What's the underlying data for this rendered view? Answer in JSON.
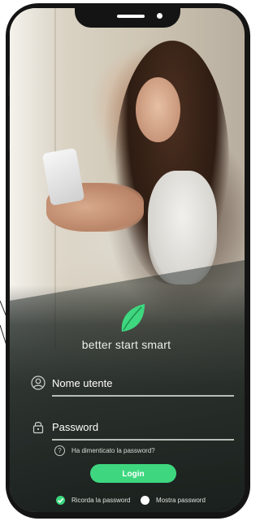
{
  "brand": {
    "slogan": "better start smart",
    "accent_color": "#3ed77f",
    "logo_icon": "leaf-icon"
  },
  "form": {
    "username": {
      "placeholder": "Nome utente",
      "icon": "user-icon"
    },
    "password": {
      "placeholder": "Password",
      "icon": "lock-icon"
    },
    "forgot_password": {
      "label": "Ha dimenticato la password?",
      "icon": "question-icon"
    },
    "login_button": {
      "label": "Login"
    },
    "remember_password": {
      "label": "Ricorda la password",
      "checked": true
    },
    "show_password": {
      "label": "Mostra password",
      "checked": false
    }
  }
}
